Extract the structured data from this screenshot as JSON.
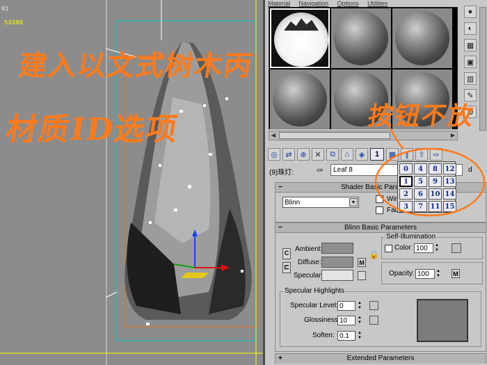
{
  "viewport": {
    "label": "01",
    "poly_count": "53388",
    "annotation_left_line1": "建入以文式树木丙",
    "annotation_left_line2": "材质ID选项",
    "annotation_right": "按钮不放"
  },
  "menu": [
    "Material",
    "Navigation",
    "Options",
    "Utilities"
  ],
  "material_name_label": "(9)珠灯:",
  "material_name_value": "Leaf 8",
  "material_type_suffix": "d",
  "mat_id_current": "1",
  "mat_id_popup": [
    "0",
    "4",
    "8",
    "12",
    "1",
    "5",
    "9",
    "13",
    "2",
    "6",
    "10",
    "14",
    "3",
    "7",
    "11",
    "15"
  ],
  "shader_rollout": {
    "title": "Shader Basic Parameters",
    "shader": "Blinn",
    "wire": "Wire",
    "face": "Face"
  },
  "blinn_rollout": {
    "title": "Blinn Basic Parameters",
    "ambient": "Ambient:",
    "diffuse": "Diffuse:",
    "specular": "Specular:",
    "self_illum_title": "Self-Illumination",
    "color_label": "Color",
    "color_value": "100",
    "opacity_label": "Opacity:",
    "opacity_value": "100",
    "map_letter": "M",
    "c_button": "C"
  },
  "spec_highlights": {
    "title": "Specular Highlights",
    "level_label": "Specular Level:",
    "level_value": "0",
    "gloss_label": "Glossiness:",
    "gloss_value": "10",
    "soften_label": "Soften:",
    "soften_value": "0.1"
  },
  "extended_rollout": {
    "title": "Extended Parameters"
  },
  "colors": {
    "annotation": "#ff7a1a",
    "viewport_bg": "#8c8c8c",
    "panel_bg": "#c8c8c8"
  }
}
